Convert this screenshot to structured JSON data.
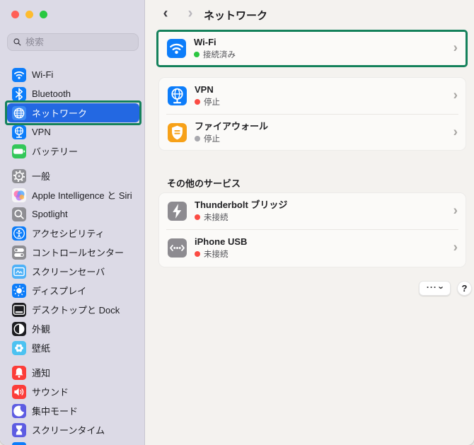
{
  "window": {
    "traffic_lights": [
      {
        "name": "close",
        "color": "#ff5f57"
      },
      {
        "name": "minimize",
        "color": "#febc2e"
      },
      {
        "name": "zoom",
        "color": "#28c840"
      }
    ]
  },
  "sidebar": {
    "search": {
      "placeholder": "検索"
    },
    "groups": [
      {
        "items": [
          {
            "id": "wifi",
            "label": "Wi-Fi",
            "icon": "wifi",
            "icon_color": "#0d7dfa",
            "selected": false,
            "annotated": false
          },
          {
            "id": "bluetooth",
            "label": "Bluetooth",
            "icon": "bluetooth",
            "icon_color": "#0d7dfa",
            "selected": false,
            "annotated": false
          },
          {
            "id": "network",
            "label": "ネットワーク",
            "icon": "globe",
            "icon_color": "#3d8bf2",
            "selected": true,
            "annotated": true
          },
          {
            "id": "vpn",
            "label": "VPN",
            "icon": "globe-stand",
            "icon_color": "#0d7dfa",
            "selected": false,
            "annotated": false
          },
          {
            "id": "battery",
            "label": "バッテリー",
            "icon": "battery",
            "icon_color": "#33c759",
            "selected": false,
            "annotated": false
          }
        ]
      },
      {
        "items": [
          {
            "id": "general",
            "label": "一般",
            "icon": "gear",
            "icon_color": "#8e8e93",
            "selected": false,
            "annotated": false
          },
          {
            "id": "apple-intelligence-siri",
            "label": "Apple Intelligence と Siri",
            "icon": "siri",
            "icon_color": "#f5f5f7",
            "selected": false,
            "annotated": false
          },
          {
            "id": "spotlight",
            "label": "Spotlight",
            "icon": "magnifier",
            "icon_color": "#8e8e93",
            "selected": false,
            "annotated": false
          },
          {
            "id": "accessibility",
            "label": "アクセシビリティ",
            "icon": "accessibility",
            "icon_color": "#0d7dfa",
            "selected": false,
            "annotated": false
          },
          {
            "id": "control-center",
            "label": "コントロールセンター",
            "icon": "toggles",
            "icon_color": "#8e8e93",
            "selected": false,
            "annotated": false
          },
          {
            "id": "screen-saver",
            "label": "スクリーンセーバ",
            "icon": "screensaver",
            "icon_color": "#4eb1f7",
            "selected": false,
            "annotated": false
          },
          {
            "id": "display",
            "label": "ディスプレイ",
            "icon": "sun",
            "icon_color": "#0d7dfa",
            "selected": false,
            "annotated": false
          },
          {
            "id": "desktop-dock",
            "label": "デスクトップと Dock",
            "icon": "desktop-dock",
            "icon_color": "#1d1d21",
            "selected": false,
            "annotated": false
          },
          {
            "id": "appearance",
            "label": "外観",
            "icon": "half-circle",
            "icon_color": "#1d1d21",
            "selected": false,
            "annotated": false
          },
          {
            "id": "wallpaper",
            "label": "壁紙",
            "icon": "flower",
            "icon_color": "#4cc2f1",
            "selected": false,
            "annotated": false
          }
        ]
      },
      {
        "items": [
          {
            "id": "notifications",
            "label": "通知",
            "icon": "bell",
            "icon_color": "#fc3d39",
            "selected": false,
            "annotated": false
          },
          {
            "id": "sound",
            "label": "サウンド",
            "icon": "speaker",
            "icon_color": "#fc3d39",
            "selected": false,
            "annotated": false
          },
          {
            "id": "focus",
            "label": "集中モード",
            "icon": "moon",
            "icon_color": "#5d5ce2",
            "selected": false,
            "annotated": false
          },
          {
            "id": "screen-time",
            "label": "スクリーンタイム",
            "icon": "hourglass",
            "icon_color": "#5d5ce2",
            "selected": false,
            "annotated": false
          }
        ]
      }
    ]
  },
  "header": {
    "back_arrow": "‹",
    "forward_arrow": "›",
    "title": "ネットワーク"
  },
  "content": {
    "wifi_card": {
      "annotated": true,
      "annotation_color": "#14815b",
      "rows": [
        {
          "id": "wifi",
          "title": "Wi-Fi",
          "status": "接続済み",
          "dot_color": "#2cc641",
          "icon": "wifi",
          "icon_color": "#0d7dfa",
          "chevron": "›"
        }
      ]
    },
    "services_card": {
      "rows": [
        {
          "id": "vpn",
          "title": "VPN",
          "status": "停止",
          "dot_color": "#fb4b43",
          "icon": "globe-stand",
          "icon_color": "#0d7dfa",
          "chevron": "›"
        },
        {
          "id": "firewall",
          "title": "ファイアウォール",
          "status": "停止",
          "dot_color": "#a9a9ae",
          "icon": "firewall",
          "icon_color": "#f7a118",
          "chevron": "›"
        }
      ]
    },
    "section_title": "その他のサービス",
    "other_card": {
      "rows": [
        {
          "id": "thunderbolt-bridge",
          "title": "Thunderbolt ブリッジ",
          "status": "未接続",
          "dot_color": "#fb4b43",
          "icon": "bolt",
          "icon_color": "#8d8b90",
          "chevron": "›"
        },
        {
          "id": "iphone-usb",
          "title": "iPhone USB",
          "status": "未接続",
          "dot_color": "#fb4b43",
          "icon": "usb",
          "icon_color": "#8d8b90",
          "chevron": "›"
        }
      ]
    },
    "footer": {
      "more_label": "···",
      "more_chevron": "›",
      "help_label": "?"
    }
  }
}
